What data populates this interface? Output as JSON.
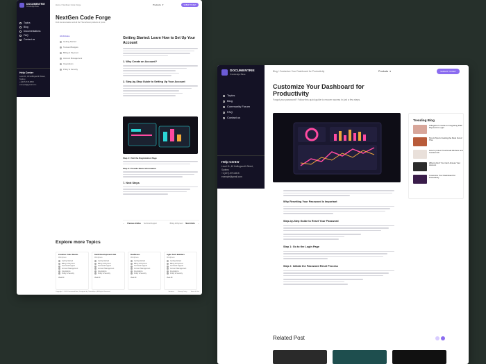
{
  "w1": {
    "logo_name": "DOCUMENTRIE",
    "logo_tag": "Knowledge Base",
    "breadcrumb": "Home / NextGen Code Forge",
    "product_label": "Products",
    "submit_label": "SUBMIT TICKET",
    "title": "NextGen Code Forge",
    "subtitle": "Find documentation and all the Themeforest products of yours.",
    "nav": [
      "Topics",
      "Blog",
      "Documentations",
      "FAQ",
      "Contact us"
    ],
    "help_title": "Help Center",
    "help_address": "Level 11, 40 Hollingworth Street, Sydney",
    "help_phone": "+1(407)-570-8815",
    "help_email": "example@gmail.com",
    "toc_head": "All Articles",
    "toc": [
      "Getting Started",
      "Tool and Budgets",
      "Billing & Payment",
      "Account Management",
      "Integrations",
      "Policy & Security"
    ],
    "article_title": "Getting Started: Learn How to Set Up Your Account",
    "h_why": "1. Why Create an Account?",
    "h_steps": "2. Step-by-Step Guide to Setting Up Your Account",
    "h_step1": "Step 1: Visit the Registration Page",
    "h_step2": "Step 2: Provide Basic Information",
    "h_next": "7. Next Steps",
    "prev_label": "Previous Articles",
    "prev_title": "Technical Support",
    "next_label": "Billing & Payment",
    "next_title": "Next Article",
    "explore": "Explore more Topics",
    "cards": [
      {
        "title": "Creative Code Studio",
        "sub": "Wordpress",
        "items": [
          "Getting Started",
          "Billing & Payment",
          "Technical Support",
          "Account Management",
          "Integrations",
          "Policy & Security"
        ],
        "more": "View All"
      },
      {
        "title": "Swift Development Hub",
        "sub": "Wordpress",
        "items": [
          "Getting Started",
          "Billing & Payment",
          "Technical Support",
          "Account Management",
          "Integrations",
          "Policy & Security"
        ],
        "more": "View All"
      },
      {
        "title": "DevNexus",
        "sub": "Wordpress",
        "items": [
          "Getting Started",
          "Billing & Payment",
          "Technical Support",
          "Account Management",
          "Integrations",
          "Policy & Security"
        ],
        "more": "View All"
      },
      {
        "title": "Agile Tech Builders",
        "sub": "Wordpress",
        "items": [
          "Getting Started",
          "Billing & Payment",
          "Technical Support",
          "Account Management",
          "Integrations",
          "Policy & Security"
        ],
        "more": "View All"
      }
    ],
    "footer_copy": "Copyright © 2024 DocumentFlow | Designed by ThemeEpic | All Rights Reserved",
    "footer_links": [
      "Services",
      "Privacy Policy",
      "Terms & Use"
    ]
  },
  "w2": {
    "logo_name": "DOCUMENTRIE",
    "logo_tag": "Knowledge Base",
    "breadcrumb": "Blog / Customize Your Dashboard for Productivity",
    "product_label": "Products",
    "submit_label": "SUBMIT TICKET",
    "title": "Customize Your Dashboard for Productivity",
    "subtitle": "Forgot your password? Follow this quick guide to recover access in just a few steps.",
    "nav": [
      "Topics",
      "Blog",
      "Community Forum",
      "FAQ",
      "Contact us"
    ],
    "help_title": "Help Center",
    "help_address": "Level 11, 40 Hollingworth Street, Sydney",
    "help_phone": "+1(407)-570-8815",
    "help_email": "example@gmail.com",
    "trending": "Trending Blog",
    "trend_items": [
      "A Beginner's Guide to Integrating PHP Payment to Login",
      "Tips & Tips for Getting the Most Out of This",
      "How to protect Your Email Address and Contact info",
      "What to Do If You Can't Access Your Account",
      "Customize Your Dashboard for Productivity"
    ],
    "h_why": "Why Resetting Your Password is Important",
    "h_guide": "Step-by-Step Guide to Reset Your Password",
    "h_step1": "Step 1: Go to the Login Page",
    "h_step2": "Step 2: Initiate the Password Reset Process",
    "related": "Related Post"
  },
  "colors": {
    "accent": "#8b6cf0",
    "sidebar": "#141225",
    "bg": "#26302b"
  }
}
